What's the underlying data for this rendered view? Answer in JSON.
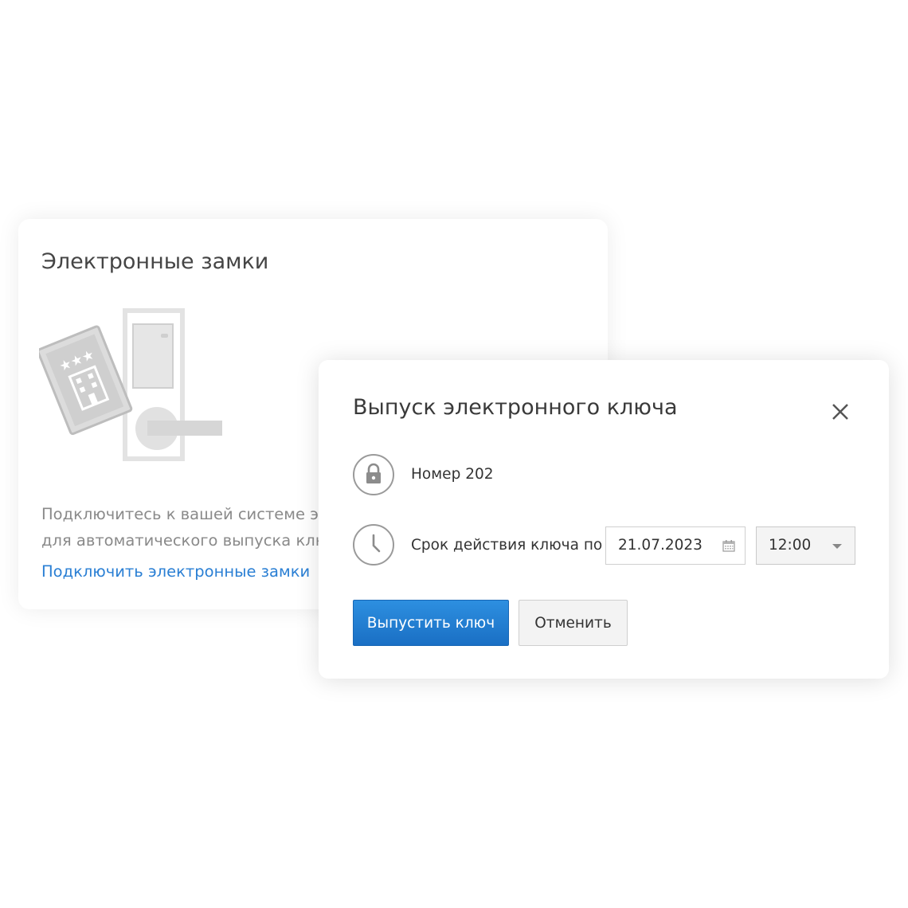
{
  "locks_card": {
    "title": "Электронные замки",
    "description_line1": "Подключитесь к вашей системе электронных замков",
    "description_line2": "для автоматического выпуска ключей",
    "link_label": "Подключить электронные замки"
  },
  "modal": {
    "title": "Выпуск электронного ключа",
    "room_label": "Номер 202",
    "validity_label": "Срок действия ключа по",
    "date_value": "21.07.2023",
    "time_value": "12:00",
    "issue_button_label": "Выпустить ключ",
    "cancel_button_label": "Отменить"
  },
  "icons": {
    "close": "close-icon",
    "lock": "lock-icon",
    "clock": "clock-icon",
    "calendar": "calendar-icon",
    "dropdown": "chevron-down-icon"
  },
  "colors": {
    "link": "#2a7fd4",
    "primary_button": "#1f7bd0"
  }
}
